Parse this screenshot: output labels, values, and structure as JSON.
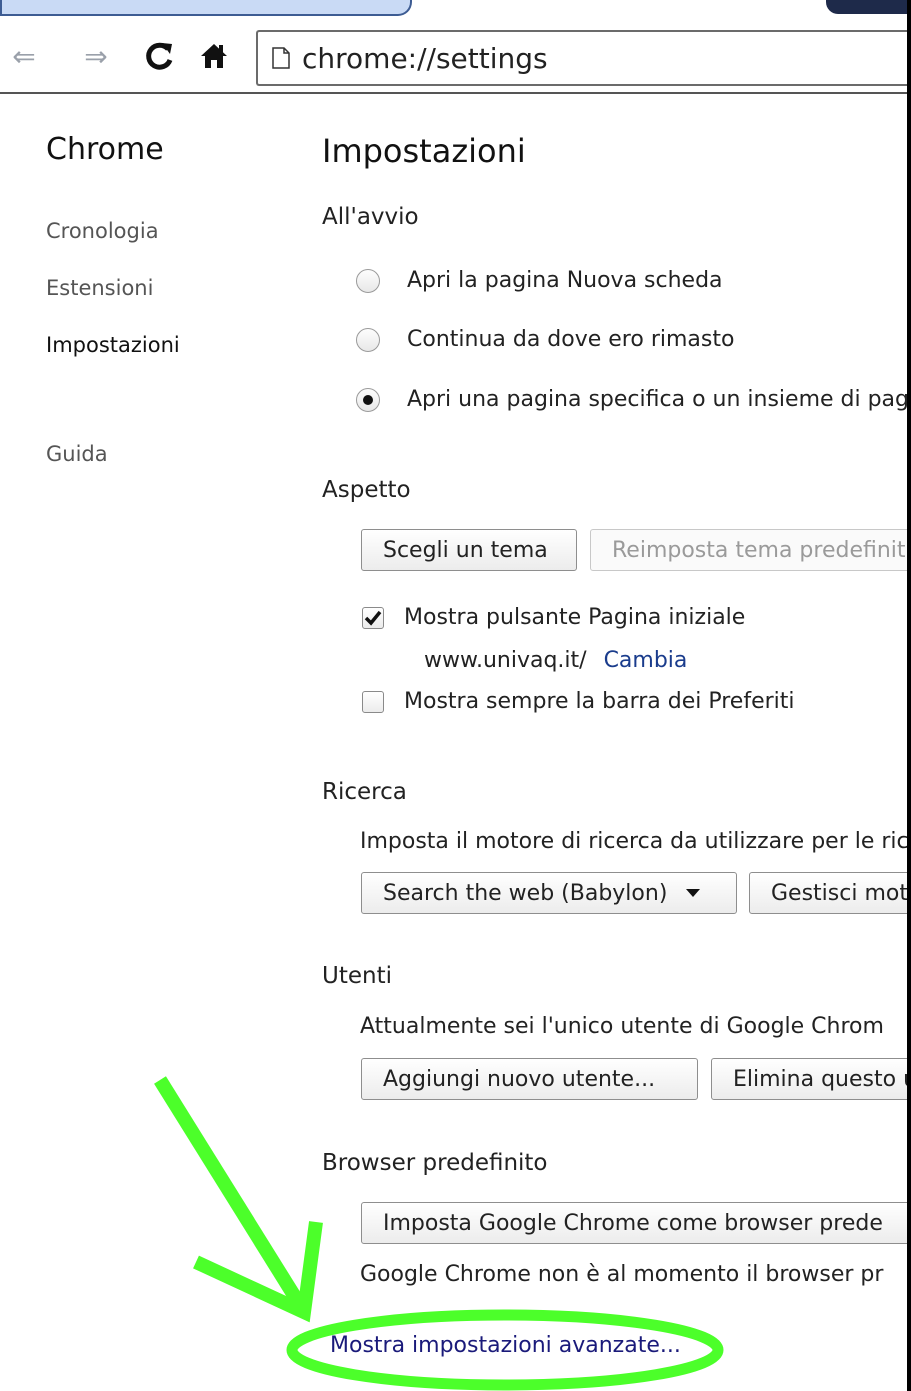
{
  "browser": {
    "url": "chrome://settings"
  },
  "sidebar": {
    "title": "Chrome",
    "items": [
      {
        "label": "Cronologia"
      },
      {
        "label": "Estensioni"
      },
      {
        "label": "Impostazioni"
      },
      {
        "label": "Guida"
      }
    ],
    "active": "Impostazioni"
  },
  "main": {
    "title": "Impostazioni",
    "startup": {
      "heading": "All'avvio",
      "options": [
        {
          "label": "Apri la pagina Nuova scheda",
          "selected": false
        },
        {
          "label": "Continua da dove ero rimasto",
          "selected": false
        },
        {
          "label": "Apri una pagina specifica o un insieme di pag",
          "selected": true
        }
      ]
    },
    "appearance": {
      "heading": "Aspetto",
      "choose_theme": "Scegli un tema",
      "reset_theme": "Reimposta tema predefinit",
      "show_home": "Mostra pulsante Pagina iniziale",
      "show_home_checked": true,
      "home_url": "www.univaq.it/",
      "change_link": "Cambia",
      "show_bookmarks": "Mostra sempre la barra dei Preferiti",
      "show_bookmarks_checked": false
    },
    "search": {
      "heading": "Ricerca",
      "description": "Imposta il motore di ricerca da utilizzare per le ric",
      "engine_select": "Search the web (Babylon)",
      "manage_button": "Gestisci mot"
    },
    "users": {
      "heading": "Utenti",
      "description": "Attualmente sei l'unico utente di Google Chrom",
      "add_button": "Aggiungi nuovo utente...",
      "delete_button": "Elimina questo u"
    },
    "default_browser": {
      "heading": "Browser predefinito",
      "set_button": "Imposta Google Chrome come browser prede",
      "status": "Google Chrome non è al momento il browser pr"
    },
    "advanced_link": "Mostra impostazioni avanzate..."
  },
  "annotation": {
    "color": "#4cff2a"
  }
}
